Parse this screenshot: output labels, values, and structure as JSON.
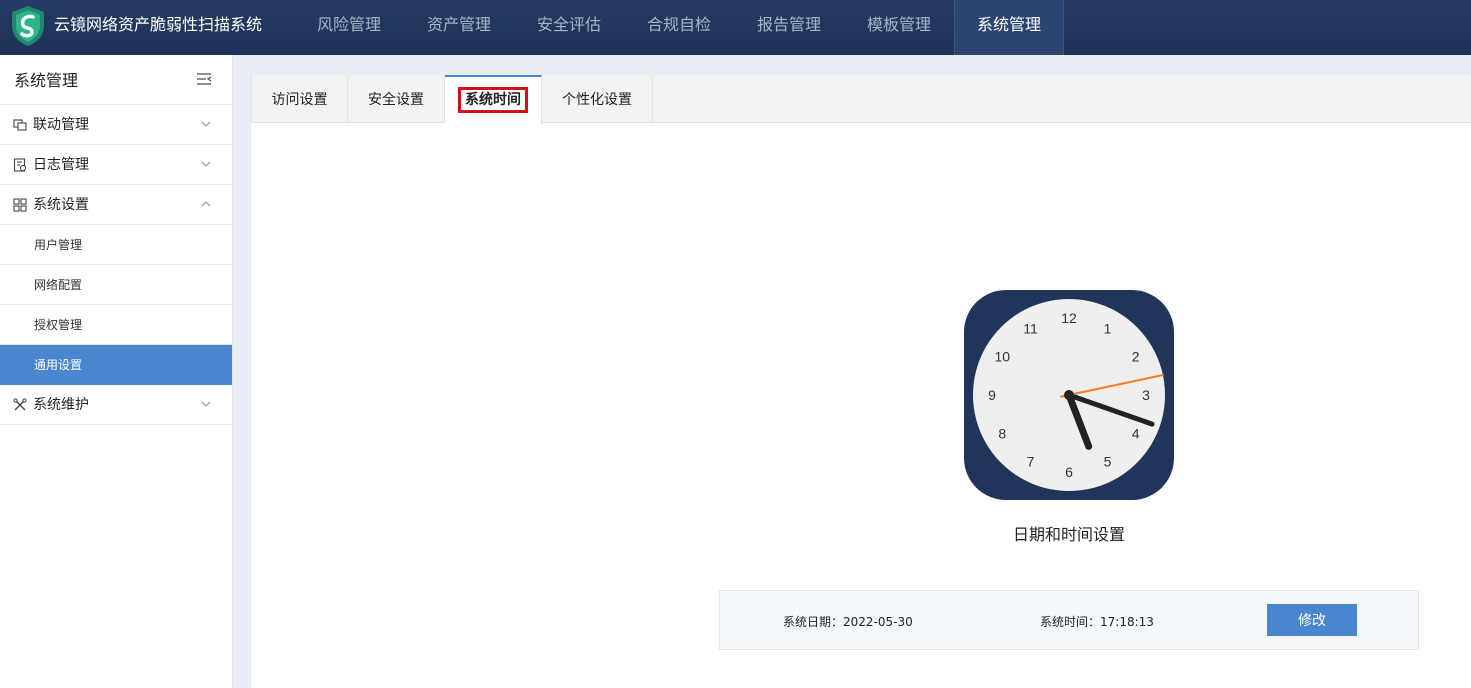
{
  "app": {
    "title": "云镜网络资产脆弱性扫描系统",
    "logo_icon": "shield-logo-icon"
  },
  "nav": [
    {
      "label": "风险管理",
      "active": false
    },
    {
      "label": "资产管理",
      "active": false
    },
    {
      "label": "安全评估",
      "active": false
    },
    {
      "label": "合规自检",
      "active": false
    },
    {
      "label": "报告管理",
      "active": false
    },
    {
      "label": "模板管理",
      "active": false
    },
    {
      "label": "系统管理",
      "active": true
    }
  ],
  "sidebar": {
    "title": "系统管理",
    "collapse_icon": "menu-collapse-icon",
    "items": [
      {
        "label": "联动管理",
        "icon": "link-icon",
        "expanded": false
      },
      {
        "label": "日志管理",
        "icon": "log-icon",
        "expanded": false
      },
      {
        "label": "系统设置",
        "icon": "grid-icon",
        "expanded": true
      },
      {
        "label": "系统维护",
        "icon": "tools-icon",
        "expanded": false
      }
    ],
    "subitems": [
      {
        "label": "用户管理",
        "active": false
      },
      {
        "label": "网络配置",
        "active": false
      },
      {
        "label": "授权管理",
        "active": false
      },
      {
        "label": "通用设置",
        "active": true
      }
    ]
  },
  "tabs": [
    {
      "label": "访问设置",
      "active": false
    },
    {
      "label": "安全设置",
      "active": false
    },
    {
      "label": "系统时间",
      "active": true
    },
    {
      "label": "个性化设置",
      "active": false
    }
  ],
  "clock": {
    "numbers": [
      "12",
      "1",
      "2",
      "3",
      "4",
      "5",
      "6",
      "7",
      "8",
      "9",
      "10",
      "11"
    ],
    "caption": "日期和时间设置",
    "hour": 17,
    "minute": 18,
    "second": 13
  },
  "system": {
    "date_label": "系统日期：",
    "date_value": "2022-05-30",
    "time_label": "系统时间：",
    "time_value": "17:18:13",
    "modify_label": "修改"
  },
  "colors": {
    "topbar": "#1f3358",
    "accent": "#4a86cf",
    "highlight_box": "#d0121a",
    "second_hand": "#ff7a1a"
  }
}
